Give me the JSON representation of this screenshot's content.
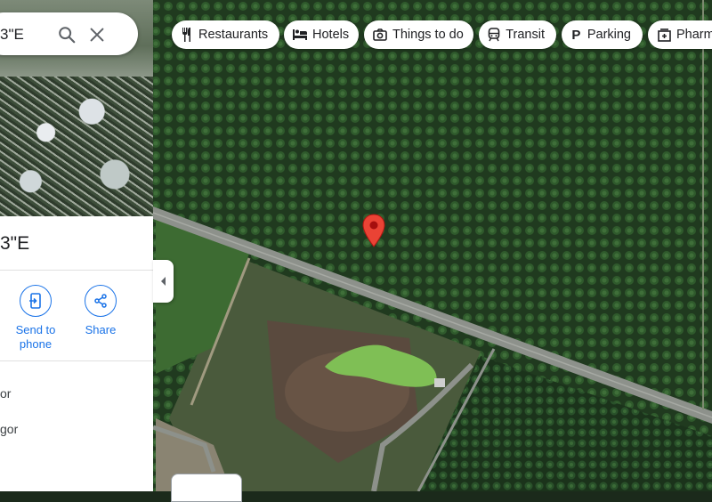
{
  "search": {
    "value": "3\"E"
  },
  "place": {
    "title": "3\"E"
  },
  "actions": [
    {
      "label_line1": "Send to",
      "label_line2": "phone",
      "icon": "send-to-phone-icon"
    },
    {
      "label": "Share",
      "icon": "share-icon"
    }
  ],
  "info_rows": [
    {
      "text": "or"
    },
    {
      "text": "gor"
    }
  ],
  "chips": [
    {
      "label": "Restaurants",
      "icon": "restaurant-icon"
    },
    {
      "label": "Hotels",
      "icon": "hotel-icon"
    },
    {
      "label": "Things to do",
      "icon": "camera-icon"
    },
    {
      "label": "Transit",
      "icon": "transit-icon"
    },
    {
      "label": "Parking",
      "icon": "parking-icon"
    },
    {
      "label": "Pharm",
      "icon": "pharmacy-icon"
    }
  ],
  "colors": {
    "accent": "#1a73e8",
    "pin": "#ea4335",
    "road": "#8a8f8a"
  }
}
